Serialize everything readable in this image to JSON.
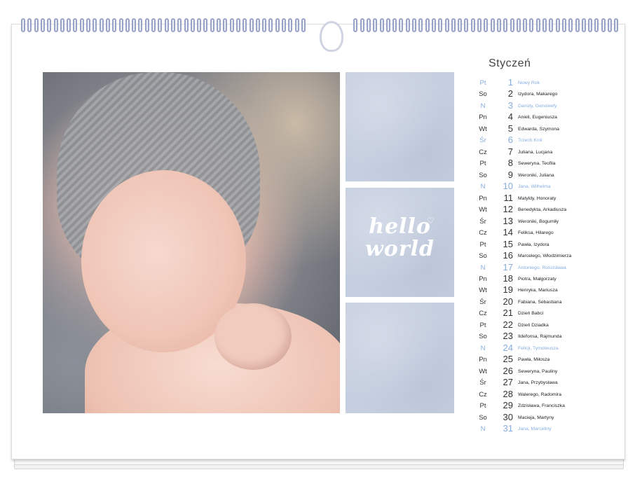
{
  "calendar": {
    "month": "Styczeń",
    "decoration": {
      "line1": "hello",
      "line2": "world"
    },
    "colors": {
      "tile": "#c6cfdf",
      "holiday": "#86aee0",
      "text": "#222222"
    },
    "days": [
      {
        "dn": "Pt",
        "num": "1",
        "names": "Nowy Rok",
        "holiday": true
      },
      {
        "dn": "So",
        "num": "2",
        "names": "Izydora, Makarego",
        "holiday": false
      },
      {
        "dn": "N",
        "num": "3",
        "names": "Danuty, Genowefy",
        "holiday": true
      },
      {
        "dn": "Pn",
        "num": "4",
        "names": "Anieli, Eugeniusza",
        "holiday": false
      },
      {
        "dn": "Wt",
        "num": "5",
        "names": "Edwarda, Szymona",
        "holiday": false
      },
      {
        "dn": "Śr",
        "num": "6",
        "names": "Trzech Król",
        "holiday": true
      },
      {
        "dn": "Cz",
        "num": "7",
        "names": "Juliana, Lucjana",
        "holiday": false
      },
      {
        "dn": "Pt",
        "num": "8",
        "names": "Seweryna, Teofila",
        "holiday": false
      },
      {
        "dn": "So",
        "num": "9",
        "names": "Weroniki, Juliana",
        "holiday": false
      },
      {
        "dn": "N",
        "num": "10",
        "names": "Jana, Wilhelma",
        "holiday": true
      },
      {
        "dn": "Pn",
        "num": "11",
        "names": "Matyldy, Honoraty",
        "holiday": false
      },
      {
        "dn": "Wt",
        "num": "12",
        "names": "Benedykta, Arkadiusza",
        "holiday": false
      },
      {
        "dn": "Śr",
        "num": "13",
        "names": "Weroniki, Bogumiły",
        "holiday": false
      },
      {
        "dn": "Cz",
        "num": "14",
        "names": "Feliksa, Hilarego",
        "holiday": false
      },
      {
        "dn": "Pt",
        "num": "15",
        "names": "Pawła, Izydora",
        "holiday": false
      },
      {
        "dn": "So",
        "num": "16",
        "names": "Marcelego, Włodzimierza",
        "holiday": false
      },
      {
        "dn": "N",
        "num": "17",
        "names": "Antoniego, Rościsława",
        "holiday": true
      },
      {
        "dn": "Pn",
        "num": "18",
        "names": "Piotra, Małgorzaty",
        "holiday": false
      },
      {
        "dn": "Wt",
        "num": "19",
        "names": "Henryka, Mariusza",
        "holiday": false
      },
      {
        "dn": "Śr",
        "num": "20",
        "names": "Fabiana, Sebastiana",
        "holiday": false
      },
      {
        "dn": "Cz",
        "num": "21",
        "names": "Dzień Babci",
        "holiday": false
      },
      {
        "dn": "Pt",
        "num": "22",
        "names": "Dzień Dziadka",
        "holiday": false
      },
      {
        "dn": "So",
        "num": "23",
        "names": "Ildefonsa, Rajmunda",
        "holiday": false
      },
      {
        "dn": "N",
        "num": "24",
        "names": "Felicji, Tymoteusza",
        "holiday": true
      },
      {
        "dn": "Pn",
        "num": "25",
        "names": "Pawła, Miłosza",
        "holiday": false
      },
      {
        "dn": "Wt",
        "num": "26",
        "names": "Seweryna, Pauliny",
        "holiday": false
      },
      {
        "dn": "Śr",
        "num": "27",
        "names": "Jana, Przybysława",
        "holiday": false
      },
      {
        "dn": "Cz",
        "num": "28",
        "names": "Walerego, Radomira",
        "holiday": false
      },
      {
        "dn": "Pt",
        "num": "29",
        "names": "Zdzisława, Franciszka",
        "holiday": false
      },
      {
        "dn": "So",
        "num": "30",
        "names": "Macieja, Martyny",
        "holiday": false
      },
      {
        "dn": "N",
        "num": "31",
        "names": "Jana, Marceliny",
        "holiday": true
      }
    ]
  }
}
